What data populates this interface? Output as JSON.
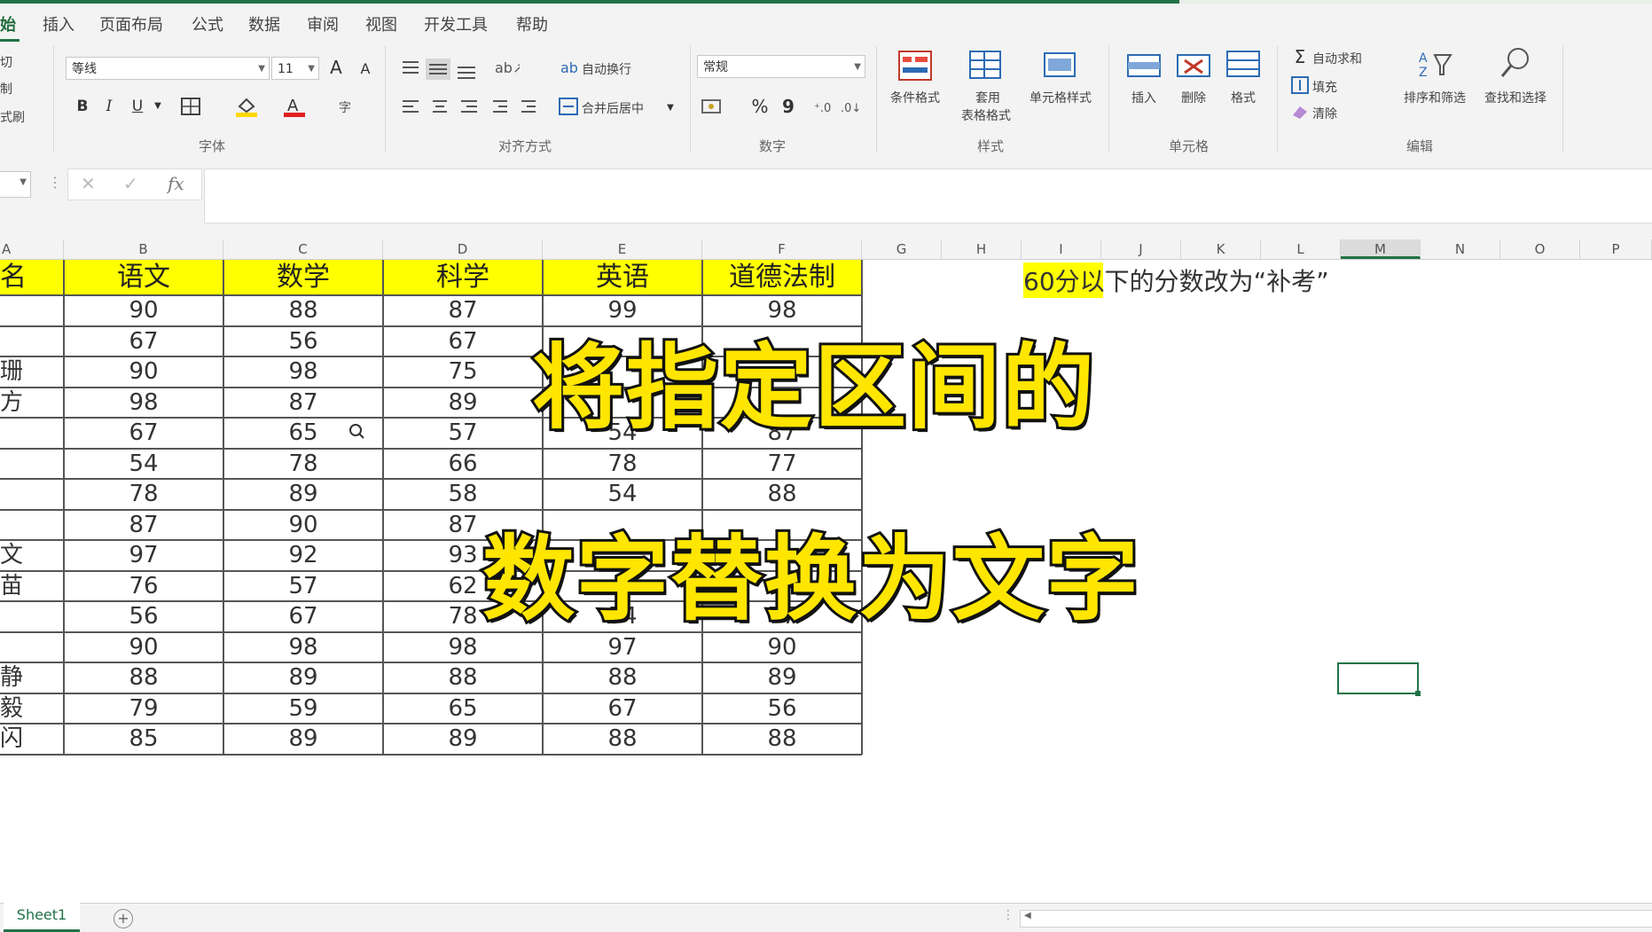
{
  "menu": {
    "tabs": [
      "始",
      "插入",
      "页面布局",
      "公式",
      "数据",
      "审阅",
      "视图",
      "开发工具",
      "帮助"
    ]
  },
  "ribbon": {
    "clipboard": {
      "cut": "切",
      "copy": "制",
      "painter": "式刷"
    },
    "font": {
      "name": "等线",
      "size": "11",
      "grow": "A",
      "shrink": "A",
      "bold": "B",
      "italic": "I",
      "underline": "U",
      "label": "字体"
    },
    "alignment": {
      "wrap": "自动换行",
      "merge": "合并后居中",
      "label": "对齐方式"
    },
    "number": {
      "format": "常规",
      "percent": "%",
      "comma": "9",
      "label": "数字"
    },
    "styles": {
      "conditional": "条件格式",
      "table_line1": "套用",
      "table_line2": "表格格式",
      "cell_styles": "单元格样式",
      "label": "样式"
    },
    "cells": {
      "insert": "插入",
      "delete": "删除",
      "format": "格式",
      "label": "单元格"
    },
    "editing": {
      "autosum": "自动求和",
      "fill": "填充",
      "clear": "清除",
      "sort": "排序和筛选",
      "find": "查找和选择",
      "label": "编辑"
    }
  },
  "formula_bar": {
    "fx": "fx",
    "cancel": "✕",
    "enter": "✓"
  },
  "columns": [
    "A",
    "B",
    "C",
    "D",
    "E",
    "F",
    "G",
    "H",
    "I",
    "J",
    "K",
    "L",
    "M",
    "N",
    "O",
    "P"
  ],
  "table": {
    "headers": [
      "名",
      "语文",
      "数学",
      "科学",
      "英语",
      "道德法制"
    ],
    "rows": [
      [
        "",
        "90",
        "88",
        "87",
        "99",
        "98"
      ],
      [
        "",
        "67",
        "56",
        "67",
        "",
        ""
      ],
      [
        "珊",
        "90",
        "98",
        "75",
        "",
        ""
      ],
      [
        "方",
        "98",
        "87",
        "89",
        "",
        ""
      ],
      [
        "",
        "67",
        "65",
        "57",
        "54",
        "87"
      ],
      [
        "",
        "54",
        "78",
        "66",
        "78",
        "77"
      ],
      [
        "",
        "78",
        "89",
        "58",
        "54",
        "88"
      ],
      [
        "",
        "87",
        "90",
        "87",
        "",
        ""
      ],
      [
        "文",
        "97",
        "92",
        "93",
        "",
        ""
      ],
      [
        "苗",
        "76",
        "57",
        "62",
        "",
        ""
      ],
      [
        "",
        "56",
        "67",
        "78",
        "54",
        "77"
      ],
      [
        "",
        "90",
        "98",
        "98",
        "97",
        "90"
      ],
      [
        "静",
        "88",
        "89",
        "88",
        "88",
        "89"
      ],
      [
        "毅",
        "79",
        "59",
        "65",
        "67",
        "56"
      ],
      [
        "闪",
        "85",
        "89",
        "89",
        "88",
        "88"
      ]
    ]
  },
  "note": "60分以下的分数改为“补考”",
  "caption": {
    "line1": "将指定区间的",
    "line2": "数字替换为文字"
  },
  "sheet": {
    "tab": "Sheet1",
    "add": "+"
  },
  "colors": {
    "accent": "#217346",
    "header_fill": "#ffff00",
    "caption": "#ffe600"
  }
}
